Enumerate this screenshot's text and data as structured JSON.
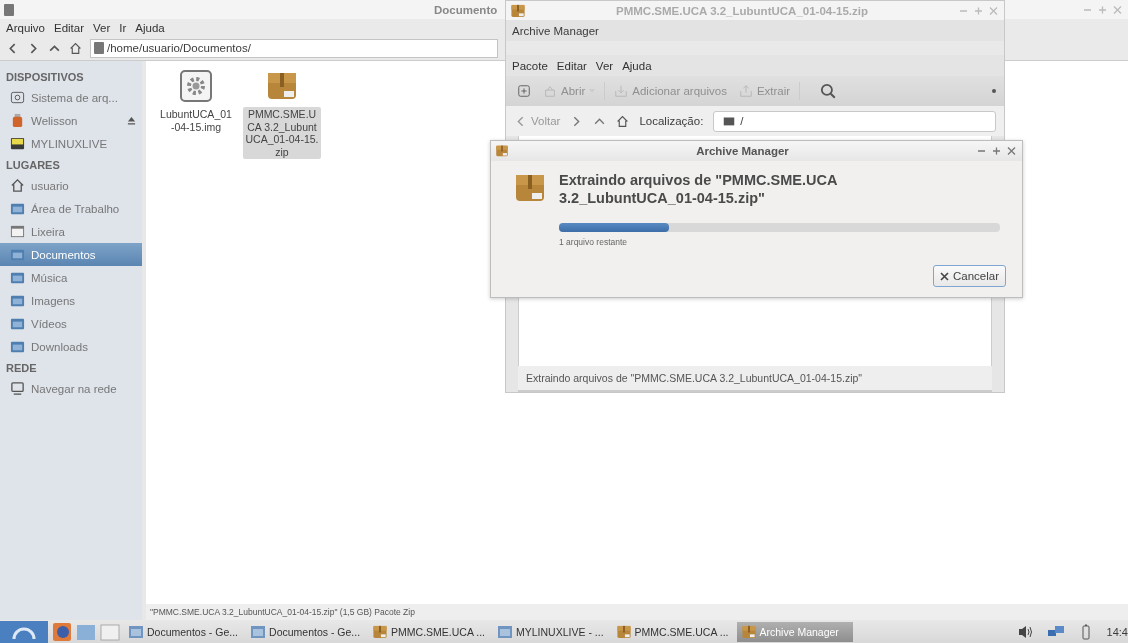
{
  "file_manager": {
    "title": "Documento",
    "menu": [
      "Arquivo",
      "Editar",
      "Ver",
      "Ir",
      "Ajuda"
    ],
    "path": "/home/usuario/Documentos/",
    "sidebar": [
      {
        "title": "DISPOSITIVOS",
        "items": [
          {
            "label": "Sistema de arq...",
            "kind": "drive",
            "selected": false,
            "eject": false
          },
          {
            "label": "Welisson",
            "kind": "usb",
            "selected": false,
            "eject": true
          },
          {
            "label": "MYLINUXLIVE",
            "kind": "disk",
            "selected": false,
            "eject": false
          }
        ]
      },
      {
        "title": "LUGARES",
        "items": [
          {
            "label": "usuario",
            "kind": "home",
            "selected": false,
            "eject": false
          },
          {
            "label": "Área de Trabalho",
            "kind": "folder",
            "selected": false,
            "eject": false
          },
          {
            "label": "Lixeira",
            "kind": "trash",
            "selected": false,
            "eject": false
          },
          {
            "label": "Documentos",
            "kind": "folder",
            "selected": true,
            "eject": false
          },
          {
            "label": "Música",
            "kind": "folder",
            "selected": false,
            "eject": false
          },
          {
            "label": "Imagens",
            "kind": "folder",
            "selected": false,
            "eject": false
          },
          {
            "label": "Vídeos",
            "kind": "folder",
            "selected": false,
            "eject": false
          },
          {
            "label": "Downloads",
            "kind": "folder",
            "selected": false,
            "eject": false
          }
        ]
      },
      {
        "title": "REDE",
        "items": [
          {
            "label": "Navegar na rede",
            "kind": "network",
            "selected": false,
            "eject": false
          }
        ]
      }
    ],
    "files": [
      {
        "name": "LubuntUCA_01-04-15.img",
        "kind": "image",
        "selected": false
      },
      {
        "name": "PMMC.SME.UCA 3.2_LubuntUCA_01-04-15.zip",
        "kind": "archive",
        "selected": true
      }
    ],
    "status": "\"PMMC.SME.UCA 3.2_LubuntUCA_01-04-15.zip\" (1,5 GB) Pacote Zip"
  },
  "archive_manager": {
    "title": "PMMC.SME.UCA 3.2_LubuntUCA_01-04-15.zip",
    "app_name": "Archive Manager",
    "menu": [
      "Pacote",
      "Editar",
      "Ver",
      "Ajuda"
    ],
    "toolbar": [
      {
        "kind": "new",
        "disabled": false
      },
      {
        "kind": "open",
        "label": "Abrir",
        "disabled": true
      },
      {
        "kind": "add",
        "label": "Adicionar arquivos",
        "disabled": true
      },
      {
        "kind": "extract",
        "label": "Extrair",
        "disabled": true
      },
      {
        "kind": "search",
        "disabled": false
      }
    ],
    "back": "Voltar",
    "location_label": "Localização:",
    "location": "/",
    "status": "Extraindo arquivos de \"PMMC.SME.UCA 3.2_LubuntUCA_01-04-15.zip\""
  },
  "dialog": {
    "title": "Archive Manager",
    "heading": "Extraindo arquivos de \"PMMC.SME.UCA 3.2_LubuntUCA_01-04-15.zip\"",
    "level": 0.25,
    "remaining": "1 arquivo restante",
    "cancel": "Cancelar"
  },
  "taskbar": {
    "tasks": [
      {
        "label": "Documentos - Ge...",
        "kind": "folder",
        "selected": false
      },
      {
        "label": "Documentos - Ge...",
        "kind": "folder",
        "selected": false
      },
      {
        "label": "PMMC.SME.UCA ...",
        "kind": "archive",
        "selected": false
      },
      {
        "label": "MYLINUXLIVE - ...",
        "kind": "folder",
        "selected": false
      },
      {
        "label": "PMMC.SME.UCA ...",
        "kind": "archive",
        "selected": false
      },
      {
        "label": "Archive Manager",
        "kind": "archive",
        "selected": true
      }
    ],
    "clock": "14:4"
  }
}
